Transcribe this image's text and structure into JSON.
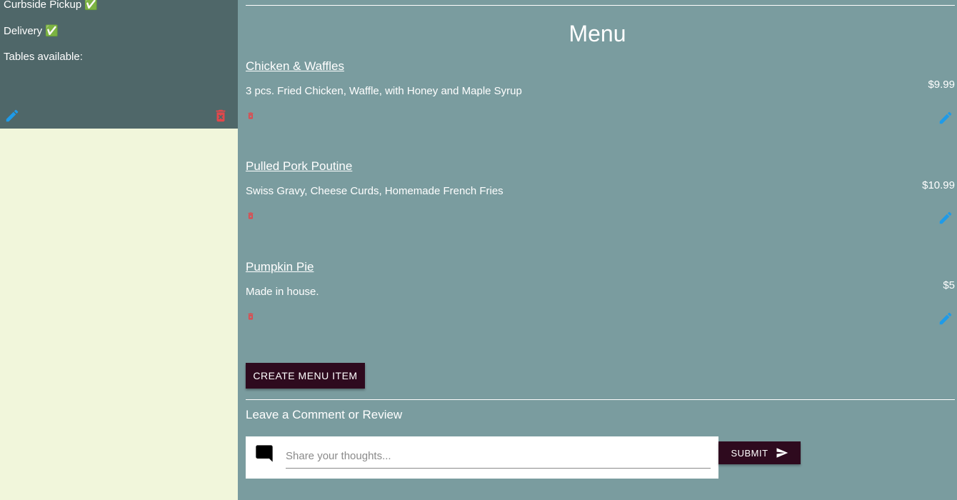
{
  "sidebar": {
    "info": {
      "curbside": "Curbside Pickup ✅",
      "delivery": "Delivery ✅",
      "tables": "Tables available:"
    }
  },
  "menu": {
    "title": "Menu",
    "items": [
      {
        "name": "Chicken & Waffles",
        "description": "3 pcs. Fried Chicken, Waffle, with Honey and Maple Syrup",
        "price": "$9.99"
      },
      {
        "name": "Pulled Pork Poutine",
        "description": "Swiss Gravy, Cheese Curds, Homemade French Fries",
        "price": "$10.99"
      },
      {
        "name": "Pumpkin Pie",
        "description": "Made in house.",
        "price": "$5"
      }
    ],
    "create_label": "CREATE MENU ITEM"
  },
  "comments": {
    "heading": "Leave a Comment or Review",
    "placeholder": "Share your thoughts...",
    "submit_label": "SUBMIT"
  },
  "colors": {
    "main_bg": "#7a9c9f",
    "card_bg": "#4f6769",
    "sidebar_bg": "#f1f6db",
    "button_bg": "#2e0a1e",
    "edit_icon": "#1e9be9",
    "delete_icon": "#e2474b"
  },
  "icons": {
    "edit": "pencil-icon",
    "delete": "trash-icon",
    "comment": "comment-icon",
    "send": "send-icon"
  }
}
